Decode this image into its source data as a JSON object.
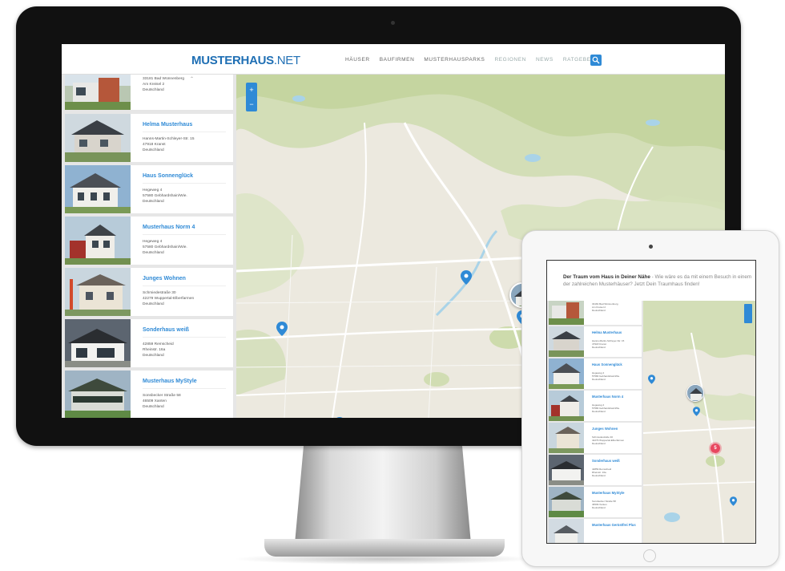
{
  "site": {
    "logo": "MUSTERHAUS",
    "logo_suffix": ".NET",
    "nav": [
      "HÄUSER",
      "BAUFIRMEN",
      "MUSTERHAUSPARKS",
      "REGIONEN",
      "NEWS",
      "RATGEBER"
    ],
    "accent": "#2f8ad6"
  },
  "map": {
    "zoom_in": "+",
    "zoom_out": "−",
    "cluster_count": "5",
    "pin_color": "#2f8ad6",
    "cluster_color": "#e8475f"
  },
  "listing": [
    {
      "name": "",
      "street": "33181 Bad Wünnenberg",
      "city": "Am Kreisel 2",
      "country": "Deutschland"
    },
    {
      "name": "Helma Musterhaus",
      "street": "Hanns-Martin-Schleyer-Str. 15",
      "city": "47918 Kranst",
      "country": "Deutschland"
    },
    {
      "name": "Haus Sonnenglück",
      "street": "Hegeweg 4",
      "city": "57580 Gebhardshain/Wie.",
      "country": "Deutschland"
    },
    {
      "name": "Musterhaus Norm 4",
      "street": "Hegeweg 4",
      "city": "57580 Gebhardshain/Wie.",
      "country": "Deutschland"
    },
    {
      "name": "Junges Wohnen",
      "street": "Schmiedestraße 30",
      "city": "42279 Wuppertal-Elberfarmen",
      "country": "Deutschland"
    },
    {
      "name": "Sonderhaus weiß",
      "street": "42859 Remscheid",
      "city": "Rheinstr. 16a",
      "country": "Deutschland"
    },
    {
      "name": "Musterhaus MyStyle",
      "street": "Sonsbecker Straße 58",
      "city": "46509 Xanten",
      "country": "Deutschland"
    }
  ],
  "ipad": {
    "intro_bold": "Der Traum vom Haus in Deiner Nähe",
    "intro_rest": " - Wie wäre es da mit einem Besuch in einem der zahlreichen Musterhäuser? Jetzt Dein Traumhaus finden!",
    "listing": [
      {
        "name": "",
        "line1": "33181 Bad Wünnenberg",
        "line2": "Am Kreisel 2",
        "line3": "Deutschland"
      },
      {
        "name": "Helma Musterhaus",
        "line1": "Hanns-Martin-Schleyer-Str. 15",
        "line2": "47918 Kranst",
        "line3": "Deutschland"
      },
      {
        "name": "Haus Sonnenglück",
        "line1": "Hegeweg 4",
        "line2": "57580 Gebhardshain/Wie.",
        "line3": "Deutschland"
      },
      {
        "name": "Musterhaus Norm 4",
        "line1": "Hegeweg 4",
        "line2": "57580 Gebhardshain/Wie.",
        "line3": "Deutschland"
      },
      {
        "name": "Junges Wohnen",
        "line1": "Schmiedestraße 30",
        "line2": "42279 Wuppertal-Elberfarmen",
        "line3": "Deutschland"
      },
      {
        "name": "Sonderhaus weiß",
        "line1": "42859 Remscheid",
        "line2": "Rheinstr. 16a",
        "line3": "Deutschland"
      },
      {
        "name": "Musterhaus MyStyle",
        "line1": "Sonsbecker Straße 58",
        "line2": "46509 Xanten",
        "line3": "Deutschland"
      },
      {
        "name": "Musterhaus Gerüstfrei Plus",
        "line1": "",
        "line2": "",
        "line3": ""
      }
    ]
  }
}
